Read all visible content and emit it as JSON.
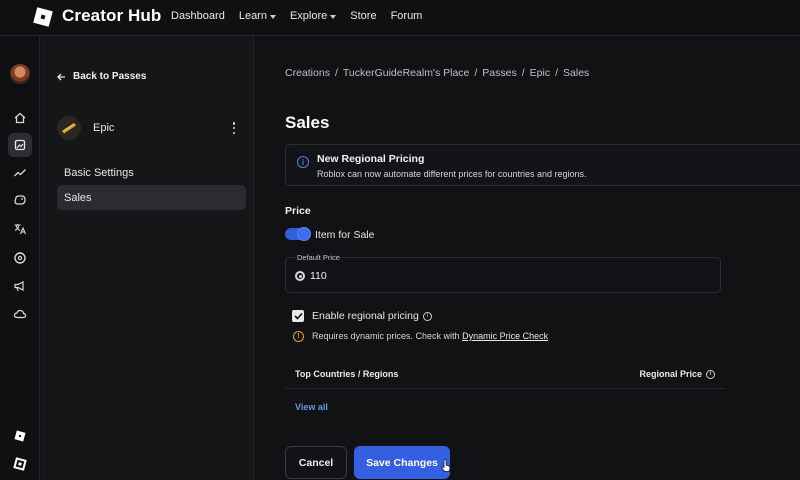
{
  "brand": {
    "name": "Creator Hub"
  },
  "nav": [
    {
      "label": "Dashboard",
      "dropdown": false
    },
    {
      "label": "Learn",
      "dropdown": true
    },
    {
      "label": "Explore",
      "dropdown": true
    },
    {
      "label": "Store",
      "dropdown": false
    },
    {
      "label": "Forum",
      "dropdown": false
    }
  ],
  "rail": {
    "icons": [
      "home-icon",
      "creations-icon",
      "analytics-icon",
      "monetization-icon",
      "localization-icon",
      "robux-icon",
      "advertising-icon",
      "cloud-icon",
      "roblox-studio-icon",
      "roblox-app-icon"
    ],
    "active": "creations-icon"
  },
  "sidebar": {
    "back_label": "Back to Passes",
    "pass_name": "Epic",
    "items": [
      {
        "label": "Basic Settings",
        "active": false
      },
      {
        "label": "Sales",
        "active": true
      }
    ]
  },
  "breadcrumb": [
    "Creations",
    "TuckerGuideRealm's Place",
    "Passes",
    "Epic",
    "Sales"
  ],
  "page": {
    "title": "Sales",
    "banner": {
      "title": "New Regional Pricing",
      "text": "Roblox can now automate different prices for countries and regions."
    },
    "price_section": "Price",
    "item_for_sale": {
      "label": "Item for Sale",
      "on": true
    },
    "default_price": {
      "label": "Default Price",
      "value": "110"
    },
    "regional": {
      "label": "Enable regional pricing",
      "checked": true,
      "warning_text": "Requires dynamic prices. Check with",
      "warning_link": "Dynamic Price Check"
    },
    "table": {
      "col_left": "Top Countries / Regions",
      "col_right": "Regional Price",
      "view_all": "View all"
    },
    "buttons": {
      "cancel": "Cancel",
      "save": "Save Changes"
    }
  },
  "colors": {
    "accent": "#335fe0",
    "link": "#6a93f2",
    "warning": "#e0a03a",
    "background": "#111214"
  }
}
